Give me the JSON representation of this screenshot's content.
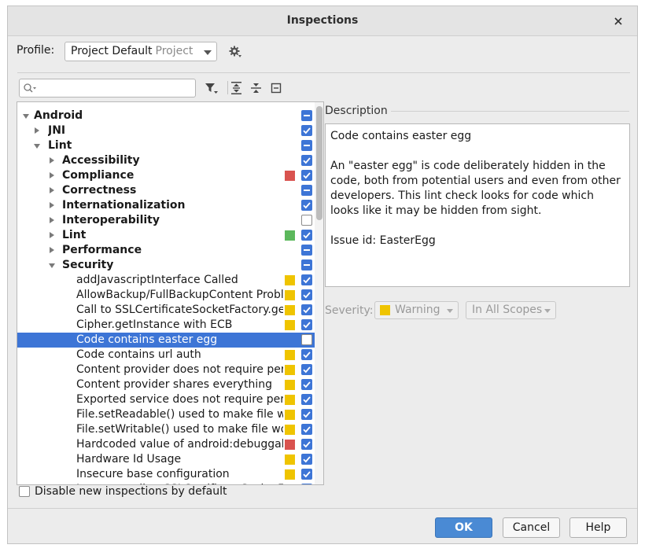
{
  "window": {
    "title": "Inspections"
  },
  "profile": {
    "label": "Profile:",
    "name": "Project Default",
    "scope": "Project"
  },
  "search": {
    "value": "",
    "placeholder": ""
  },
  "tree": {
    "rows": [
      {
        "label": "Android",
        "bold": true,
        "level": 0,
        "expand": "down",
        "swatch": null,
        "check": "mixed"
      },
      {
        "label": "JNI",
        "bold": true,
        "level": 1,
        "expand": "right",
        "swatch": null,
        "check": "checked"
      },
      {
        "label": "Lint",
        "bold": true,
        "level": 1,
        "expand": "down",
        "swatch": null,
        "check": "mixed"
      },
      {
        "label": "Accessibility",
        "bold": true,
        "level": 2,
        "expand": "right",
        "swatch": null,
        "check": "checked"
      },
      {
        "label": "Compliance",
        "bold": true,
        "level": 2,
        "expand": "right",
        "swatch": "#d9534f",
        "check": "checked"
      },
      {
        "label": "Correctness",
        "bold": true,
        "level": 2,
        "expand": "right",
        "swatch": null,
        "check": "mixed"
      },
      {
        "label": "Internationalization",
        "bold": true,
        "level": 2,
        "expand": "right",
        "swatch": null,
        "check": "checked"
      },
      {
        "label": "Interoperability",
        "bold": true,
        "level": 2,
        "expand": "right",
        "swatch": null,
        "check": "unchecked"
      },
      {
        "label": "Lint",
        "bold": true,
        "level": 2,
        "expand": "right",
        "swatch": "#5cb85c",
        "check": "checked"
      },
      {
        "label": "Performance",
        "bold": true,
        "level": 2,
        "expand": "right",
        "swatch": null,
        "check": "mixed"
      },
      {
        "label": "Security",
        "bold": true,
        "level": 2,
        "expand": "down",
        "swatch": null,
        "check": "mixed"
      },
      {
        "label": "addJavascriptInterface Called",
        "bold": false,
        "level": 3,
        "expand": null,
        "swatch": "#efc400",
        "check": "checked"
      },
      {
        "label": "AllowBackup/FullBackupContent Problems",
        "bold": false,
        "level": 3,
        "expand": null,
        "swatch": "#efc400",
        "check": "checked"
      },
      {
        "label": "Call to SSLCertificateSocketFactory.getInsecure",
        "bold": false,
        "level": 3,
        "expand": null,
        "swatch": "#efc400",
        "check": "checked"
      },
      {
        "label": "Cipher.getInstance with ECB",
        "bold": false,
        "level": 3,
        "expand": null,
        "swatch": "#efc400",
        "check": "checked"
      },
      {
        "label": "Code contains easter egg",
        "bold": false,
        "level": 3,
        "expand": null,
        "swatch": null,
        "check": "unchecked",
        "selected": true
      },
      {
        "label": "Code contains url auth",
        "bold": false,
        "level": 3,
        "expand": null,
        "swatch": "#efc400",
        "check": "checked"
      },
      {
        "label": "Content provider does not require permission",
        "bold": false,
        "level": 3,
        "expand": null,
        "swatch": "#efc400",
        "check": "checked"
      },
      {
        "label": "Content provider shares everything",
        "bold": false,
        "level": 3,
        "expand": null,
        "swatch": "#efc400",
        "check": "checked"
      },
      {
        "label": "Exported service does not require permission",
        "bold": false,
        "level": 3,
        "expand": null,
        "swatch": "#efc400",
        "check": "checked"
      },
      {
        "label": "File.setReadable() used to make file world-readable",
        "bold": false,
        "level": 3,
        "expand": null,
        "swatch": "#efc400",
        "check": "checked"
      },
      {
        "label": "File.setWritable() used to make file world-writable",
        "bold": false,
        "level": 3,
        "expand": null,
        "swatch": "#efc400",
        "check": "checked"
      },
      {
        "label": "Hardcoded value of android:debuggable",
        "bold": false,
        "level": 3,
        "expand": null,
        "swatch": "#d9534f",
        "check": "checked"
      },
      {
        "label": "Hardware Id Usage",
        "bold": false,
        "level": 3,
        "expand": null,
        "swatch": "#efc400",
        "check": "checked"
      },
      {
        "label": "Insecure base configuration",
        "bold": false,
        "level": 3,
        "expand": null,
        "swatch": "#efc400",
        "check": "checked"
      },
      {
        "label": "Insecure call to SSLCertificateSocketFactory",
        "bold": false,
        "level": 3,
        "expand": null,
        "swatch": "#efc400",
        "check": "checked"
      }
    ]
  },
  "description": {
    "title": "Description",
    "heading": "Code contains easter egg",
    "body": "An \"easter egg\" is code deliberately hidden in the code, both from potential users and even from other developers. This lint check looks for code which looks like it may be hidden from sight.",
    "issue": "Issue id: EasterEgg"
  },
  "severity": {
    "label": "Severity:",
    "value": "Warning",
    "scope": "In All Scopes"
  },
  "options": {
    "disable_new": "Disable new inspections by default"
  },
  "buttons": {
    "ok": "OK",
    "cancel": "Cancel",
    "help": "Help"
  }
}
